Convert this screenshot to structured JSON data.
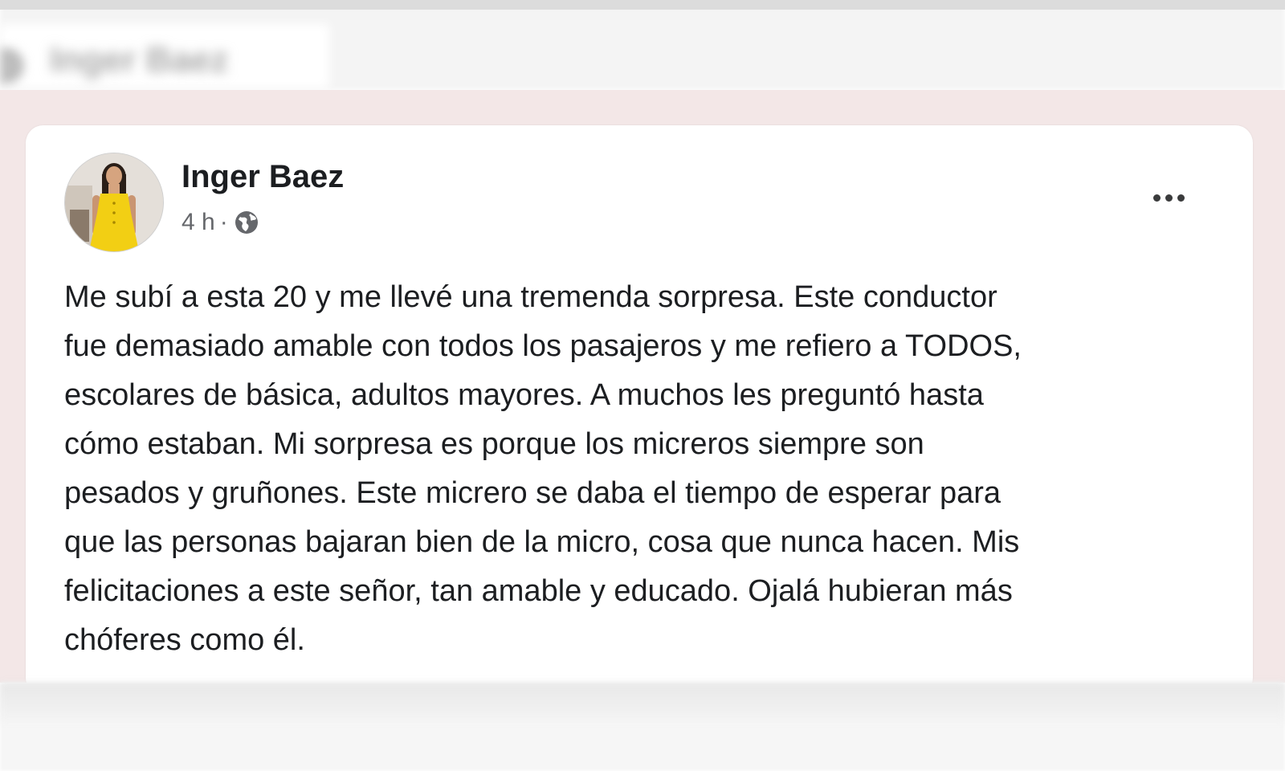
{
  "post": {
    "author": "Inger Baez",
    "time": "4 h",
    "separator": "·",
    "visibility_icon": "globe-icon",
    "menu_icon": "more-options-icon",
    "text": "Me subí a esta 20 y me llevé una tremenda sorpresa. Este conductor\nfue demasiado amable con todos los pasajeros y me refiero a TODOS,\nescolares de básica, adultos mayores. A muchos les preguntó hasta\ncómo estaban. Mi sorpresa es porque los micreros siempre son\npesados y gruñones. Este micrero se daba el tiempo de esperar para\nque las personas bajaran bien de la micro, cosa que nunca hacen. Mis\nfelicitaciones a este señor, tan amable y educado. Ojalá hubieran más\nchóferes como él."
  },
  "colors": {
    "page_bg": "#f3e7e7",
    "card_bg": "#ffffff",
    "text_primary": "#1c1e21",
    "text_secondary": "#65676b"
  }
}
